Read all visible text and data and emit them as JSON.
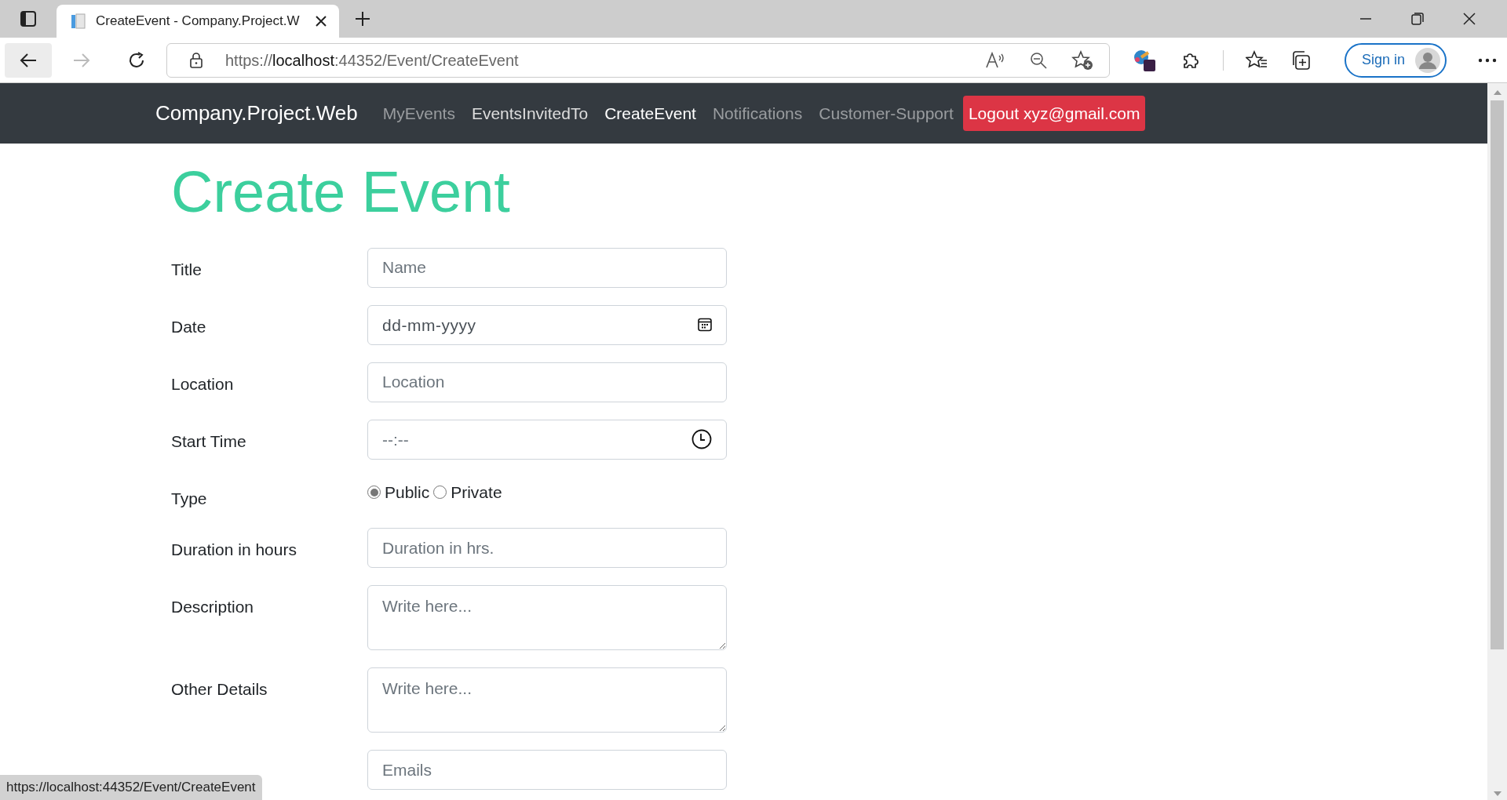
{
  "browser": {
    "tab": {
      "title": "CreateEvent - Company.Project.W"
    },
    "address": {
      "scheme": "https://",
      "host": "localhost",
      "rest": ":44352/Event/CreateEvent"
    },
    "sign_in": "Sign in"
  },
  "navbar": {
    "brand": "Company.Project.Web",
    "links": [
      {
        "label": "MyEvents",
        "selected": false,
        "hovered": false
      },
      {
        "label": "EventsInvitedTo",
        "selected": false,
        "hovered": true
      },
      {
        "label": "CreateEvent",
        "selected": true,
        "hovered": false
      },
      {
        "label": "Notifications",
        "selected": false,
        "hovered": false
      },
      {
        "label": "Customer-Support",
        "selected": false,
        "hovered": false
      }
    ],
    "logout": "Logout xyz@gmail.com"
  },
  "page": {
    "heading": "Create Event",
    "fields": [
      {
        "label": "Title",
        "kind": "text",
        "placeholder": "Name"
      },
      {
        "label": "Date",
        "kind": "date",
        "placeholder": "dd-mm-yyyy"
      },
      {
        "label": "Location",
        "kind": "text",
        "placeholder": "Location"
      },
      {
        "label": "Start Time",
        "kind": "time",
        "placeholder": "--:--"
      },
      {
        "label": "Type",
        "kind": "radio",
        "options": [
          {
            "label": "Public",
            "selected": true
          },
          {
            "label": "Private",
            "selected": false
          }
        ]
      },
      {
        "label": "Duration in hours",
        "kind": "text",
        "placeholder": "Duration in hrs."
      },
      {
        "label": "Description",
        "kind": "textarea",
        "placeholder": "Write here..."
      },
      {
        "label": "Other Details",
        "kind": "textarea",
        "placeholder": "Write here..."
      },
      {
        "kind": "text",
        "placeholder": "Emails"
      }
    ]
  },
  "status_bar": {
    "url": "https://localhost:44352/Event/CreateEvent"
  }
}
